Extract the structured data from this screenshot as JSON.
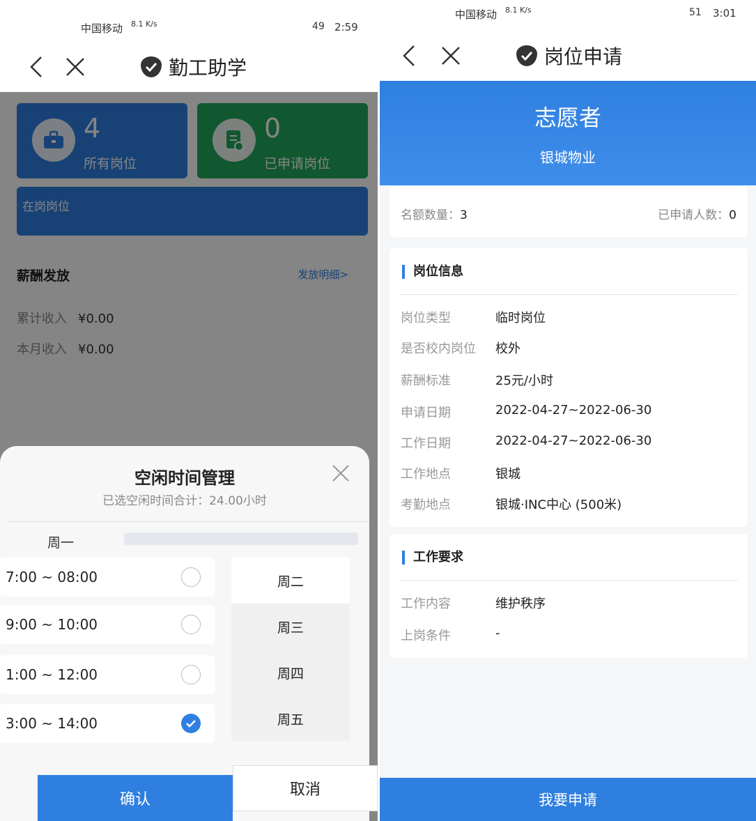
{
  "left": {
    "status": {
      "carrier": "中国移动",
      "speed": "8.1 K/s",
      "battery": "49",
      "time": "2:59"
    },
    "nav": {
      "title": "勤工助学"
    },
    "cards": [
      {
        "count": "4",
        "label": "所有岗位"
      },
      {
        "count": "0",
        "label": "已申请岗位"
      }
    ],
    "on_post": "在岗岗位",
    "salary": {
      "title": "薪酬发放",
      "detail_link": "发放明细>",
      "total_label": "累计收入",
      "total_value": "¥0.00",
      "month_label": "本月收入",
      "month_value": "¥0.00"
    },
    "sheet": {
      "title": "空闲时间管理",
      "subtitle": "已选空闲时间合计：24.00小时",
      "current_day": "周一",
      "days": [
        "周二",
        "周三",
        "周四",
        "周五"
      ],
      "slots": [
        {
          "time": "7:00 ~ 08:00",
          "checked": false
        },
        {
          "time": "9:00 ~ 10:00",
          "checked": false
        },
        {
          "time": "1:00 ~ 12:00",
          "checked": false
        },
        {
          "time": "3:00 ~ 14:00",
          "checked": true
        }
      ],
      "confirm": "确认",
      "cancel": "取消"
    }
  },
  "right": {
    "status": {
      "carrier": "中国移动",
      "speed": "8.1 K/s",
      "battery": "51",
      "time": "3:01"
    },
    "nav": {
      "title": "岗位申请"
    },
    "job": {
      "name": "志愿者",
      "org": "银城物业"
    },
    "quota": {
      "label": "名额数量：",
      "value": "3",
      "applied_label": "已申请人数：",
      "applied_value": "0"
    },
    "info": {
      "title": "岗位信息",
      "rows": [
        {
          "k": "岗位类型",
          "v": "临时岗位"
        },
        {
          "k": "是否校内岗位",
          "v": "校外"
        },
        {
          "k": "薪酬标准",
          "v": "25元/小时"
        },
        {
          "k": "申请日期",
          "v": "2022-04-27~2022-06-30"
        },
        {
          "k": "工作日期",
          "v": "2022-04-27~2022-06-30"
        },
        {
          "k": "工作地点",
          "v": "银城"
        },
        {
          "k": "考勤地点",
          "v": "银城·INC中心 (500米)"
        }
      ]
    },
    "req": {
      "title": "工作要求",
      "rows": [
        {
          "k": "工作内容",
          "v": "维护秩序"
        },
        {
          "k": "上岗条件",
          "v": "-"
        }
      ]
    },
    "apply": "我要申请"
  }
}
